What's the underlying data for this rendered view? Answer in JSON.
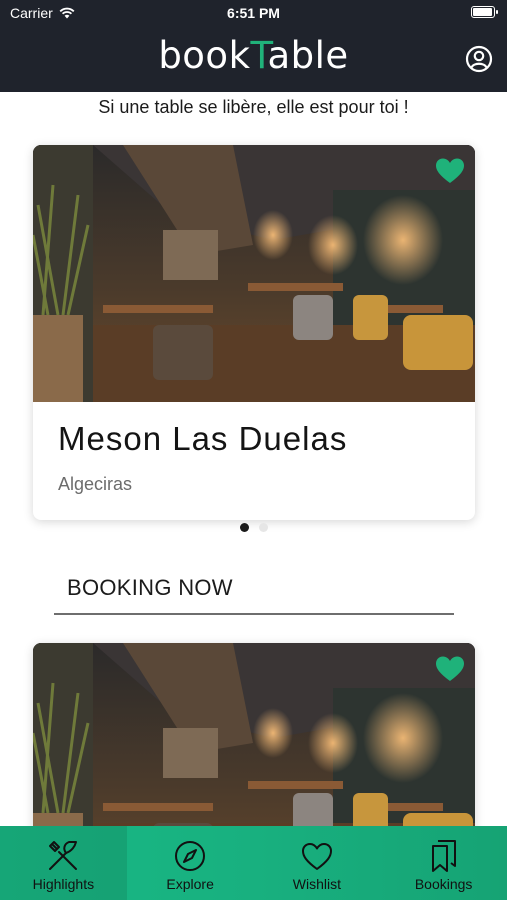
{
  "status_bar": {
    "carrier": "Carrier",
    "time": "6:51 PM"
  },
  "header": {
    "logo_part1": "book",
    "logo_accent": "T",
    "logo_part2": "able"
  },
  "tagline": "Si une table se libère, elle est pour toi !",
  "featured": {
    "name": "Meson Las Duelas",
    "city": "Algeciras",
    "carousel_pages": 2,
    "carousel_active": 1
  },
  "booking_section": {
    "title": "BOOKING NOW",
    "card": {
      "name": "",
      "city": ""
    }
  },
  "tabs": [
    {
      "label": "Highlights",
      "icon": "fork-knife-icon",
      "active": true
    },
    {
      "label": "Explore",
      "icon": "compass-icon",
      "active": false
    },
    {
      "label": "Wishlist",
      "icon": "heart-outline-icon",
      "active": false
    },
    {
      "label": "Bookings",
      "icon": "bookmarks-icon",
      "active": false
    }
  ],
  "colors": {
    "header_bg": "#1f232c",
    "accent": "#20b27a",
    "tabbar": "#18b07f"
  }
}
